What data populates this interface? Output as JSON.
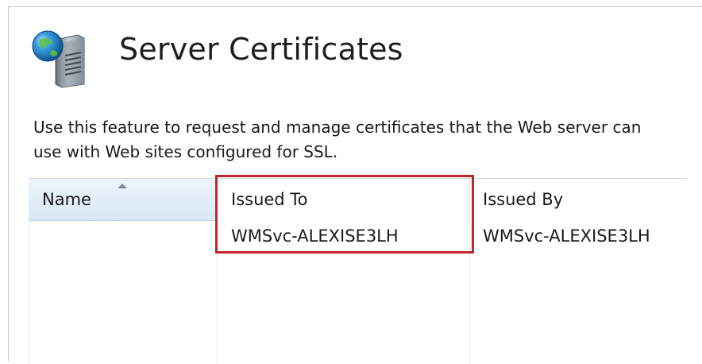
{
  "page": {
    "title": "Server Certificates",
    "description": "Use this feature to request and manage certificates that the Web server can use with Web sites configured for SSL."
  },
  "table": {
    "columns": [
      "Name",
      "Issued To",
      "Issued By"
    ],
    "sorted_column": "Name",
    "rows": [
      {
        "name": "",
        "issued_to": "WMSvc-ALEXISE3LH",
        "issued_by": "WMSvc-ALEXISE3LH"
      }
    ]
  },
  "highlight": {
    "color": "#c0282e",
    "target": "Issued To"
  },
  "icons": {
    "header": "server-certificates-icon",
    "sort": "sort-ascending-icon"
  }
}
